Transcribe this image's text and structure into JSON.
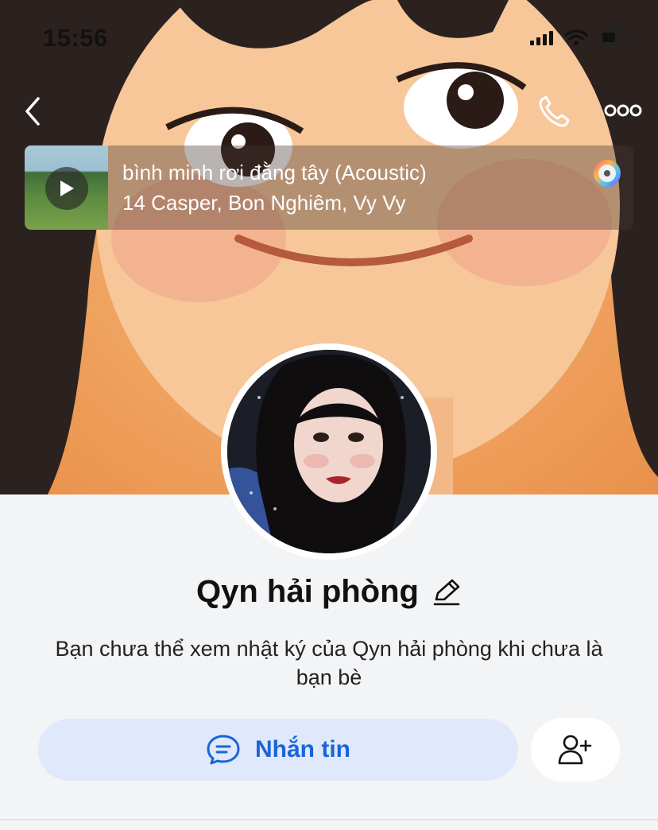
{
  "status_bar": {
    "time": "15:56",
    "battery_level": 0.45
  },
  "nav": {
    "back_icon": "chevron-left-icon",
    "call_icon": "phone-icon",
    "more_icon": "more-dots-icon"
  },
  "music": {
    "title": "bình minh rơi đằng tây (Acoustic)",
    "artist": "14 Casper, Bon Nghiêm, Vy Vy"
  },
  "profile": {
    "name": "Qyn hải phòng",
    "notice": "Bạn chưa thể xem nhật ký của Qyn hải phòng khi chưa là bạn bè"
  },
  "actions": {
    "message_label": "Nhắn tin"
  },
  "colors": {
    "accent": "#1a64d8",
    "button_bg": "#dfe9fb",
    "page_bg": "#f3f4f6"
  }
}
